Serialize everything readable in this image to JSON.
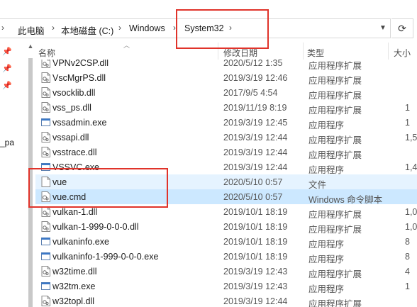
{
  "address": {
    "crumbs": [
      "此电脑",
      "本地磁盘 (C:)",
      "Windows",
      "System32"
    ],
    "dropdown_icon": "chevron-down-icon",
    "refresh_icon": "refresh-icon"
  },
  "nav_pane": {
    "partial_label": "_pa"
  },
  "columns": {
    "name": "名称",
    "date": "修改日期",
    "type": "类型",
    "size": "大小"
  },
  "files": [
    {
      "name": "VPNv2CSP.dll",
      "date": "2020/5/12 1:35",
      "type": "应用程序扩展",
      "size": "",
      "icon": "dll-file-icon"
    },
    {
      "name": "VscMgrPS.dll",
      "date": "2019/3/19 12:46",
      "type": "应用程序扩展",
      "size": "",
      "icon": "dll-file-icon"
    },
    {
      "name": "vsocklib.dll",
      "date": "2017/9/5 4:54",
      "type": "应用程序扩展",
      "size": "",
      "icon": "dll-file-icon"
    },
    {
      "name": "vss_ps.dll",
      "date": "2019/11/19 8:19",
      "type": "应用程序扩展",
      "size": "1",
      "icon": "dll-file-icon"
    },
    {
      "name": "vssadmin.exe",
      "date": "2019/3/19 12:45",
      "type": "应用程序",
      "size": "1",
      "icon": "exe-file-icon"
    },
    {
      "name": "vssapi.dll",
      "date": "2019/3/19 12:44",
      "type": "应用程序扩展",
      "size": "1,5",
      "icon": "dll-file-icon"
    },
    {
      "name": "vsstrace.dll",
      "date": "2019/3/19 12:44",
      "type": "应用程序扩展",
      "size": "",
      "icon": "dll-file-icon"
    },
    {
      "name": "VSSVC.exe",
      "date": "2019/3/19 12:44",
      "type": "应用程序",
      "size": "1,4",
      "icon": "exe-file-icon"
    },
    {
      "name": "vue",
      "date": "2020/5/10 0:57",
      "type": "文件",
      "size": "",
      "icon": "blank-file-icon"
    },
    {
      "name": "vue.cmd",
      "date": "2020/5/10 0:57",
      "type": "Windows 命令脚本",
      "size": "",
      "icon": "cmd-file-icon"
    },
    {
      "name": "vulkan-1.dll",
      "date": "2019/10/1 18:19",
      "type": "应用程序扩展",
      "size": "1,0",
      "icon": "dll-file-icon"
    },
    {
      "name": "vulkan-1-999-0-0-0.dll",
      "date": "2019/10/1 18:19",
      "type": "应用程序扩展",
      "size": "1,0",
      "icon": "dll-file-icon"
    },
    {
      "name": "vulkaninfo.exe",
      "date": "2019/10/1 18:19",
      "type": "应用程序",
      "size": "8",
      "icon": "exe-file-icon"
    },
    {
      "name": "vulkaninfo-1-999-0-0-0.exe",
      "date": "2019/10/1 18:19",
      "type": "应用程序",
      "size": "8",
      "icon": "exe-file-icon"
    },
    {
      "name": "w32time.dll",
      "date": "2019/3/19 12:43",
      "type": "应用程序扩展",
      "size": "4",
      "icon": "dll-file-icon"
    },
    {
      "name": "w32tm.exe",
      "date": "2019/3/19 12:43",
      "type": "应用程序",
      "size": "1",
      "icon": "exe-file-icon"
    },
    {
      "name": "w32topl.dll",
      "date": "2019/3/19 12:44",
      "type": "应用程序扩展",
      "size": "",
      "icon": "dll-file-icon"
    }
  ],
  "colors": {
    "selected_row": "#cce8ff",
    "hover_row": "#e5f3ff",
    "annotation_box": "#e0332a"
  }
}
